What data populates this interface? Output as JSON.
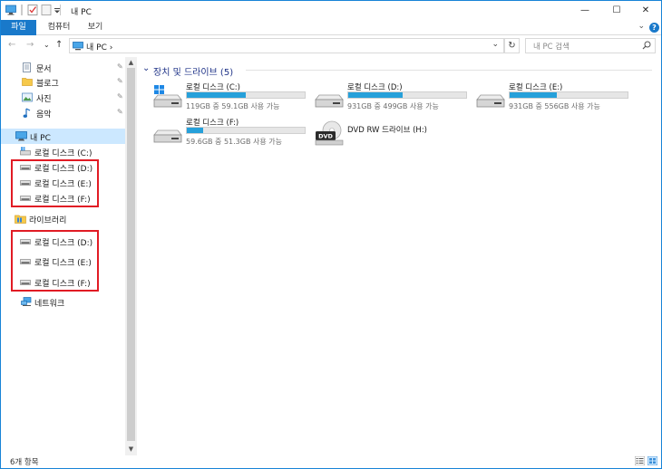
{
  "window": {
    "title": "내 PC",
    "minimize_label": "—",
    "maximize_label": "☐",
    "close_label": "✕"
  },
  "ribbon": {
    "tabs": [
      {
        "label": "파일",
        "active": true
      },
      {
        "label": "컴퓨터",
        "active": false
      },
      {
        "label": "보기",
        "active": false
      }
    ],
    "help_label": "?",
    "collapse_label": "⌄"
  },
  "navbar": {
    "back": "←",
    "forward": "→",
    "recent": "⌄",
    "up": "↑",
    "address_path": "내 PC  ›",
    "address_drop": "⌄",
    "refresh": "↻",
    "search_placeholder": "내 PC 검색"
  },
  "sidebar": {
    "quick_access": [
      {
        "label": "문서",
        "icon": "documents-icon",
        "pinned": true
      },
      {
        "label": "블로그",
        "icon": "folder-icon",
        "pinned": true
      },
      {
        "label": "사진",
        "icon": "pictures-icon",
        "pinned": true
      },
      {
        "label": "음악",
        "icon": "music-icon",
        "pinned": true
      }
    ],
    "pin_glyph": "✎",
    "this_pc": {
      "label": "내 PC",
      "selected": true
    },
    "pc_drives": [
      {
        "label": "로컬 디스크 (C:)"
      },
      {
        "label": "로컬 디스크 (D:)"
      },
      {
        "label": "로컬 디스크 (E:)"
      },
      {
        "label": "로컬 디스크 (F:)"
      }
    ],
    "libraries": {
      "label": "라이브러리"
    },
    "lib_drives": [
      {
        "label": "로컬 디스크 (D:)"
      },
      {
        "label": "로컬 디스크 (E:)"
      },
      {
        "label": "로컬 디스크 (F:)"
      }
    ],
    "network": {
      "label": "네트워크"
    }
  },
  "content": {
    "group_title": "장치 및 드라이브 (5)",
    "group_chevron": "⌄",
    "drives": [
      {
        "name": "로컬 디스크 (C:)",
        "free": "119GB 중 59.1GB 사용 가능",
        "used_fraction": 0.5,
        "icon": "windows-drive-icon"
      },
      {
        "name": "로컬 디스크 (D:)",
        "free": "931GB 중 499GB 사용 가능",
        "used_fraction": 0.46,
        "icon": "hard-drive-icon"
      },
      {
        "name": "로컬 디스크 (E:)",
        "free": "931GB 중 556GB 사용 가능",
        "used_fraction": 0.4,
        "icon": "hard-drive-icon"
      },
      {
        "name": "로컬 디스크 (F:)",
        "free": "59.6GB 중 51.3GB 사용 가능",
        "used_fraction": 0.14,
        "icon": "hard-drive-icon"
      },
      {
        "name": "DVD RW 드라이브 (H:)",
        "free": "",
        "used_fraction": null,
        "icon": "dvd-drive-icon"
      }
    ]
  },
  "statusbar": {
    "item_count": "6개 항목"
  },
  "colors": {
    "accent": "#1979ca",
    "bar_fill": "#26a0da",
    "highlight_box": "#e11b24",
    "selected_bg": "#cce8ff"
  }
}
